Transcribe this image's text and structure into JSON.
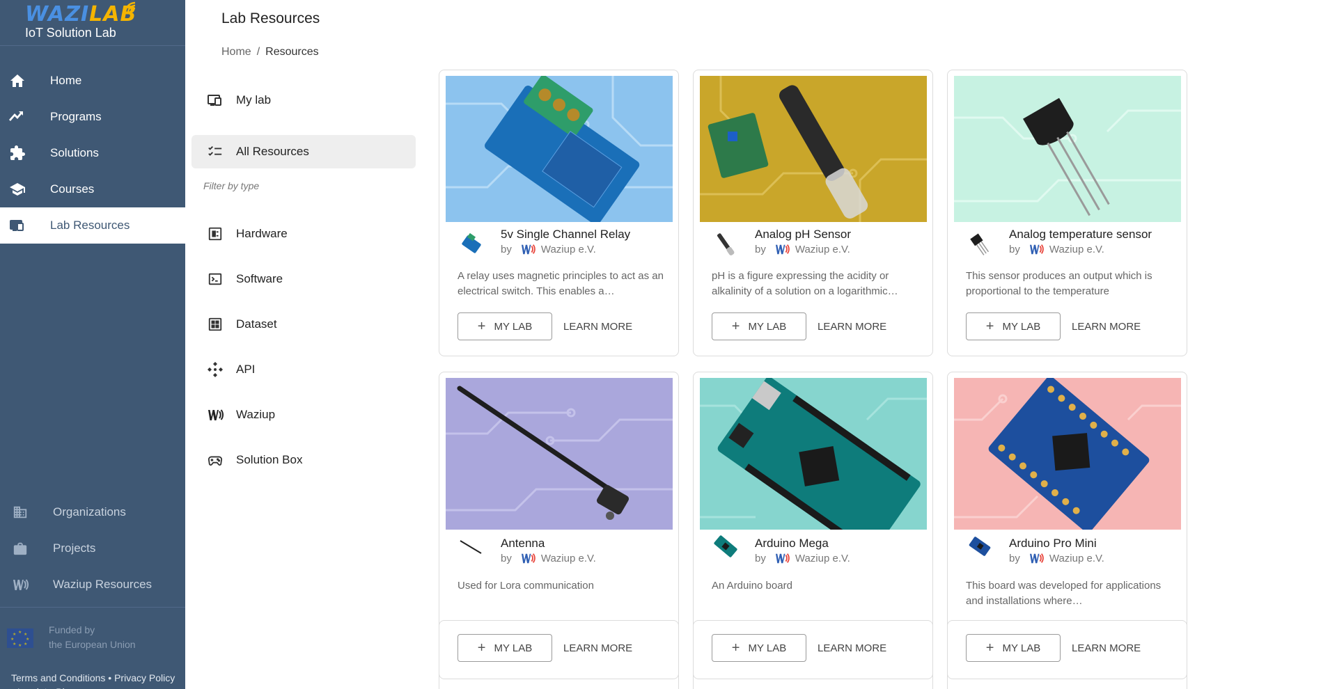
{
  "brand": {
    "logo_main": "WAZI",
    "logo_accent": "LAB",
    "subtitle": "IoT Solution Lab"
  },
  "sidebar": {
    "items": [
      {
        "label": "Home",
        "icon": "home-icon"
      },
      {
        "label": "Programs",
        "icon": "trend-icon"
      },
      {
        "label": "Solutions",
        "icon": "puzzle-icon"
      },
      {
        "label": "Courses",
        "icon": "school-icon"
      },
      {
        "label": "Lab Resources",
        "icon": "devices-icon",
        "active": true
      }
    ],
    "lower_items": [
      {
        "label": "Organizations",
        "icon": "building-icon"
      },
      {
        "label": "Projects",
        "icon": "briefcase-icon"
      },
      {
        "label": "Waziup Resources",
        "icon": "waziup-icon"
      }
    ],
    "funded_line1": "Funded by",
    "funded_line2": "the European Union",
    "footer_links": "Terms and Conditions • Privacy Policy • Imprint • Blog"
  },
  "header": {
    "title": "Lab Resources",
    "breadcrumb_home": "Home",
    "breadcrumb_sep": "/",
    "breadcrumb_current": "Resources"
  },
  "filter": {
    "my_lab": "My lab",
    "all_resources": "All Resources",
    "filter_label": "Filter by type",
    "types": [
      "Hardware",
      "Software",
      "Dataset",
      "API",
      "Waziup",
      "Solution Box"
    ]
  },
  "card_labels": {
    "by": "by",
    "publisher": "Waziup e.V.",
    "my_lab": "MY LAB",
    "learn_more": "LEARN MORE"
  },
  "cards": [
    {
      "title": "5v Single Channel Relay",
      "desc": "A relay uses magnetic principles to act as an electrical switch. This enables a…",
      "bg": "#8cc3ee"
    },
    {
      "title": "Analog pH Sensor",
      "desc": "pH is a figure expressing the acidity or alkalinity of a solution on a logarithmic…",
      "bg": "#c9a62a"
    },
    {
      "title": "Analog temperature sensor",
      "desc": "This sensor produces an output which is proportional to the temperature",
      "bg": "#c7f2e2"
    },
    {
      "title": "Antenna",
      "desc": "Used for Lora communication",
      "bg": "#aaa7dc"
    },
    {
      "title": "Arduino Mega",
      "desc": "An Arduino board",
      "bg": "#86d5ce"
    },
    {
      "title": "Arduino Pro Mini",
      "desc": "This board was developed for applications and installations where…",
      "bg": "#f6b5b4"
    }
  ],
  "colors": {
    "sidebar": "#3f5874",
    "accent_blue": "#4a90e2",
    "accent_yellow": "#f4b400",
    "waziup_red": "#e8453c"
  }
}
